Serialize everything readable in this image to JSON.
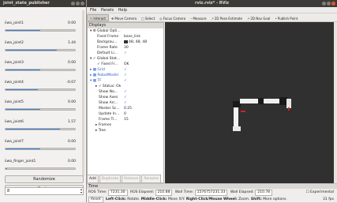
{
  "jsp": {
    "title": "joint_state_publisher",
    "joints": [
      {
        "name": "iiwa_joint1",
        "value": "0.00",
        "fill": 0.5
      },
      {
        "name": "iiwa_joint2",
        "value": "1.44",
        "fill": 0.74
      },
      {
        "name": "iiwa_joint3",
        "value": "0.00",
        "fill": 0.5
      },
      {
        "name": "iiwa_joint4",
        "value": "-0.07",
        "fill": 0.47
      },
      {
        "name": "iiwa_joint5",
        "value": "0.00",
        "fill": 0.5
      },
      {
        "name": "iiwa_joint6",
        "value": "1.57",
        "fill": 0.78
      },
      {
        "name": "iiwa_joint7",
        "value": "0.00",
        "fill": 0.5
      },
      {
        "name": "iiwa_finger_joint1",
        "value": "0.00",
        "fill": 0.02
      }
    ],
    "randomize_label": "Randomize",
    "center_label": "Center",
    "spin_value": "8"
  },
  "rviz": {
    "title": "rviz.rviz* - RViz",
    "menu": [
      "File",
      "Panels",
      "Help"
    ],
    "tools": [
      {
        "label": "Interact",
        "icon": "pointer-icon",
        "glyph": "↖",
        "active": true
      },
      {
        "label": "Move Camera",
        "icon": "move-camera-icon",
        "glyph": "✥",
        "active": false
      },
      {
        "label": "Select",
        "icon": "select-icon",
        "glyph": "□",
        "active": false
      },
      {
        "label": "Focus Camera",
        "icon": "focus-camera-icon",
        "glyph": "◎",
        "active": false
      },
      {
        "label": "Measure",
        "icon": "measure-icon",
        "glyph": "─",
        "active": false
      },
      {
        "label": "2D Pose Estimate",
        "icon": "pose-estimate-icon",
        "glyph": "↗",
        "active": false
      },
      {
        "label": "2D Nav Goal",
        "icon": "nav-goal-icon",
        "glyph": "↗",
        "active": false
      },
      {
        "label": "Publish Point",
        "icon": "publish-point-icon",
        "glyph": "•",
        "active": false
      }
    ],
    "displays_title": "Displays",
    "tree": [
      {
        "key": "▾ ⚙ Global Opti...",
        "val": "",
        "indent": 3,
        "cls": ""
      },
      {
        "key": "Fixed Frame",
        "val": "base_link",
        "indent": 12,
        "cls": ""
      },
      {
        "key": "Backgrou...",
        "val": "48; 48; 48",
        "indent": 12,
        "cls": "",
        "swatch": true
      },
      {
        "key": "Frame Rate",
        "val": "30",
        "indent": 12,
        "cls": ""
      },
      {
        "key": "Default Li...",
        "val": "✓",
        "indent": 12,
        "cls": ""
      },
      {
        "key": "▾ ✓ Global Stat...",
        "val": "",
        "indent": 3,
        "cls": ""
      },
      {
        "key": "✓ Fixed Fr...",
        "val": "OK",
        "indent": 12,
        "cls": ""
      },
      {
        "key": "▸ ▦ Grid",
        "val": "✓",
        "indent": 3,
        "cls": "blue"
      },
      {
        "key": "▸ ▦ RobotModel",
        "val": "✓",
        "indent": 3,
        "cls": "blue"
      },
      {
        "key": "▾ ▦ TF",
        "val": "✓",
        "indent": 3,
        "cls": "blue"
      },
      {
        "key": "▸ ✓ Status: Ok",
        "val": "",
        "indent": 10,
        "cls": ""
      },
      {
        "key": "Show Na...",
        "val": "✓",
        "indent": 14,
        "cls": ""
      },
      {
        "key": "Show Axes",
        "val": "✓",
        "indent": 14,
        "cls": ""
      },
      {
        "key": "Show Arr...",
        "val": "✓",
        "indent": 14,
        "cls": ""
      },
      {
        "key": "Marker Sc...",
        "val": "0.25",
        "indent": 14,
        "cls": ""
      },
      {
        "key": "Update In...",
        "val": "0",
        "indent": 14,
        "cls": ""
      },
      {
        "key": "Frame Ti...",
        "val": "15",
        "indent": 14,
        "cls": ""
      },
      {
        "key": "▸ Frames",
        "val": "",
        "indent": 10,
        "cls": ""
      },
      {
        "key": "▸ Tree",
        "val": "",
        "indent": 10,
        "cls": ""
      }
    ],
    "display_buttons": {
      "add": "Add",
      "duplicate": "Duplicate",
      "remove": "Remove",
      "rename": "Rename"
    },
    "time": {
      "title": "Time",
      "ros_time_label": "ROS Time:",
      "ros_time": "7231.30",
      "ros_elapsed_label": "ROS Elapsed:",
      "ros_elapsed": "210.88",
      "wall_time_label": "Wall Time:",
      "wall_time": "1576757231.33",
      "wall_elapsed_label": "Wall Elapsed:",
      "wall_elapsed": "210.78",
      "experimental": "Experimental"
    },
    "status": {
      "reset": "Reset",
      "hint_bold1": "Left-Click:",
      "hint1": " Rotate. ",
      "hint_bold2": "Middle-Click:",
      "hint2": " Move X/Y. ",
      "hint_bold3": "Right-Click/Mouse Wheel:",
      "hint3": " Zoom. ",
      "hint_bold4": "Shift:",
      "hint4": " More options.",
      "fps": "31 fps"
    }
  },
  "colors": {
    "viewport_bg": "#303030",
    "accent": "#3c7ed6",
    "titlebar": "#3c3b37"
  }
}
